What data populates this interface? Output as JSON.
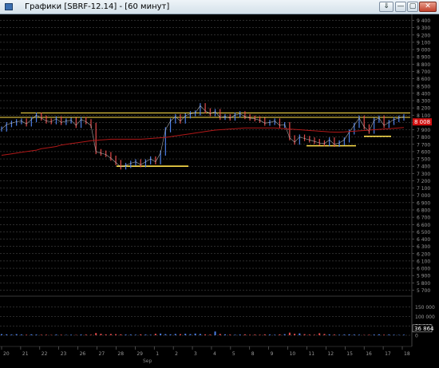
{
  "window": {
    "title": "Графики [SBRF-12.14] - [60 минут]",
    "buttons": {
      "pin": "⇓",
      "minimize": "—",
      "maximize": "▢",
      "close": "✕"
    }
  },
  "price_axis": {
    "labels": [
      "9 400",
      "9 300",
      "9 200",
      "9 100",
      "9 000",
      "8 900",
      "8 800",
      "8 700",
      "8 600",
      "8 500",
      "8 400",
      "8 300",
      "8 200",
      "8 100",
      "8 000",
      "7 900",
      "7 800",
      "7 700",
      "7 600",
      "7 500",
      "7 400",
      "7 300",
      "7 200",
      "7 100",
      "7 000",
      "6 900",
      "6 800",
      "6 700",
      "6 600",
      "6 500",
      "6 400",
      "6 300",
      "6 200",
      "6 100",
      "6 000",
      "5 900",
      "5 800",
      "5 700"
    ],
    "current_price": "8 008",
    "min": 5650,
    "max": 9450
  },
  "volume_axis": {
    "labels": [
      "150 000",
      "100 000",
      "50 000",
      "0"
    ],
    "current_volume": "36 864",
    "max": 170000
  },
  "time_axis": {
    "labels": [
      "20",
      "21",
      "22",
      "23",
      "26",
      "27",
      "28",
      "29",
      "1",
      "2",
      "3",
      "4",
      "5",
      "8",
      "9",
      "10",
      "11",
      "12",
      "15",
      "16",
      "17",
      "18"
    ],
    "month_label": "Sep"
  },
  "chart_data": {
    "type": "line",
    "series": [
      {
        "values": [
          7910,
          7970,
          7990,
          8010,
          8020,
          7980,
          8040,
          8100,
          8060,
          8020,
          8010,
          8050,
          8000,
          8020,
          8030,
          7960,
          8040,
          8010,
          7960,
          7600,
          7580,
          7560,
          7510,
          7450,
          7390,
          7410,
          7440,
          7460,
          7420,
          7460,
          7500,
          7460,
          7580,
          7900,
          8020,
          8080,
          8020,
          8090,
          8120,
          8130,
          8230,
          8160,
          8120,
          8150,
          8070,
          8080,
          8060,
          8100,
          8120,
          8080,
          8060,
          8050,
          8030,
          7990,
          8000,
          8020,
          7960,
          7970,
          7790,
          7730,
          7800,
          7780,
          7760,
          7740,
          7720,
          7710,
          7760,
          7700,
          7720,
          7760,
          7870,
          7960,
          8060,
          7940,
          7880,
          8030,
          8060,
          7960,
          8000,
          8040,
          8060,
          8080
        ]
      },
      {
        "values": [
          7550,
          7560,
          7570,
          7580,
          7590,
          7600,
          7610,
          7620,
          7640,
          7650,
          7660,
          7670,
          7690,
          7700,
          7710,
          7720,
          7730,
          7740,
          7750,
          7755,
          7760,
          7765,
          7770,
          7770,
          7770,
          7770,
          7770,
          7770,
          7770,
          7775,
          7780,
          7785,
          7790,
          7795,
          7805,
          7815,
          7825,
          7835,
          7845,
          7855,
          7865,
          7875,
          7885,
          7895,
          7900,
          7905,
          7910,
          7915,
          7920,
          7925,
          7925,
          7925,
          7925,
          7925,
          7925,
          7925,
          7920,
          7915,
          7910,
          7905,
          7900,
          7895,
          7890,
          7885,
          7880,
          7875,
          7870,
          7868,
          7868,
          7870,
          7875,
          7880,
          7885,
          7890,
          7895,
          7900,
          7905,
          7910,
          7915,
          7920,
          7925,
          7930
        ]
      }
    ],
    "volume": {
      "values": [
        6000,
        5000,
        4000,
        6000,
        4000,
        3000,
        5000,
        4000,
        3000,
        3000,
        2000,
        4000,
        3000,
        2000,
        3000,
        2000,
        4000,
        4000,
        3000,
        12000,
        8000,
        5000,
        7000,
        6000,
        5000,
        4000,
        4000,
        3000,
        5000,
        4000,
        3000,
        8000,
        9000,
        6000,
        5000,
        7000,
        6000,
        8000,
        6000,
        9000,
        7000,
        5000,
        4000,
        20000,
        7000,
        5000,
        4000,
        3000,
        4000,
        5000,
        3000,
        4000,
        3000,
        5000,
        4000,
        3000,
        5000,
        6000,
        14000,
        8000,
        10000,
        6000,
        4000,
        3000,
        11000,
        7000,
        5000,
        4000,
        3000,
        4000,
        5000,
        4000,
        3000,
        2000,
        3000,
        4000,
        5000,
        3000,
        4000,
        3000,
        2000,
        3000
      ]
    },
    "support_lines": [
      {
        "value": 8130
      },
      {
        "value": 8070
      },
      {
        "value": 7400
      },
      {
        "value": 7680
      },
      {
        "value": 7810
      }
    ]
  }
}
